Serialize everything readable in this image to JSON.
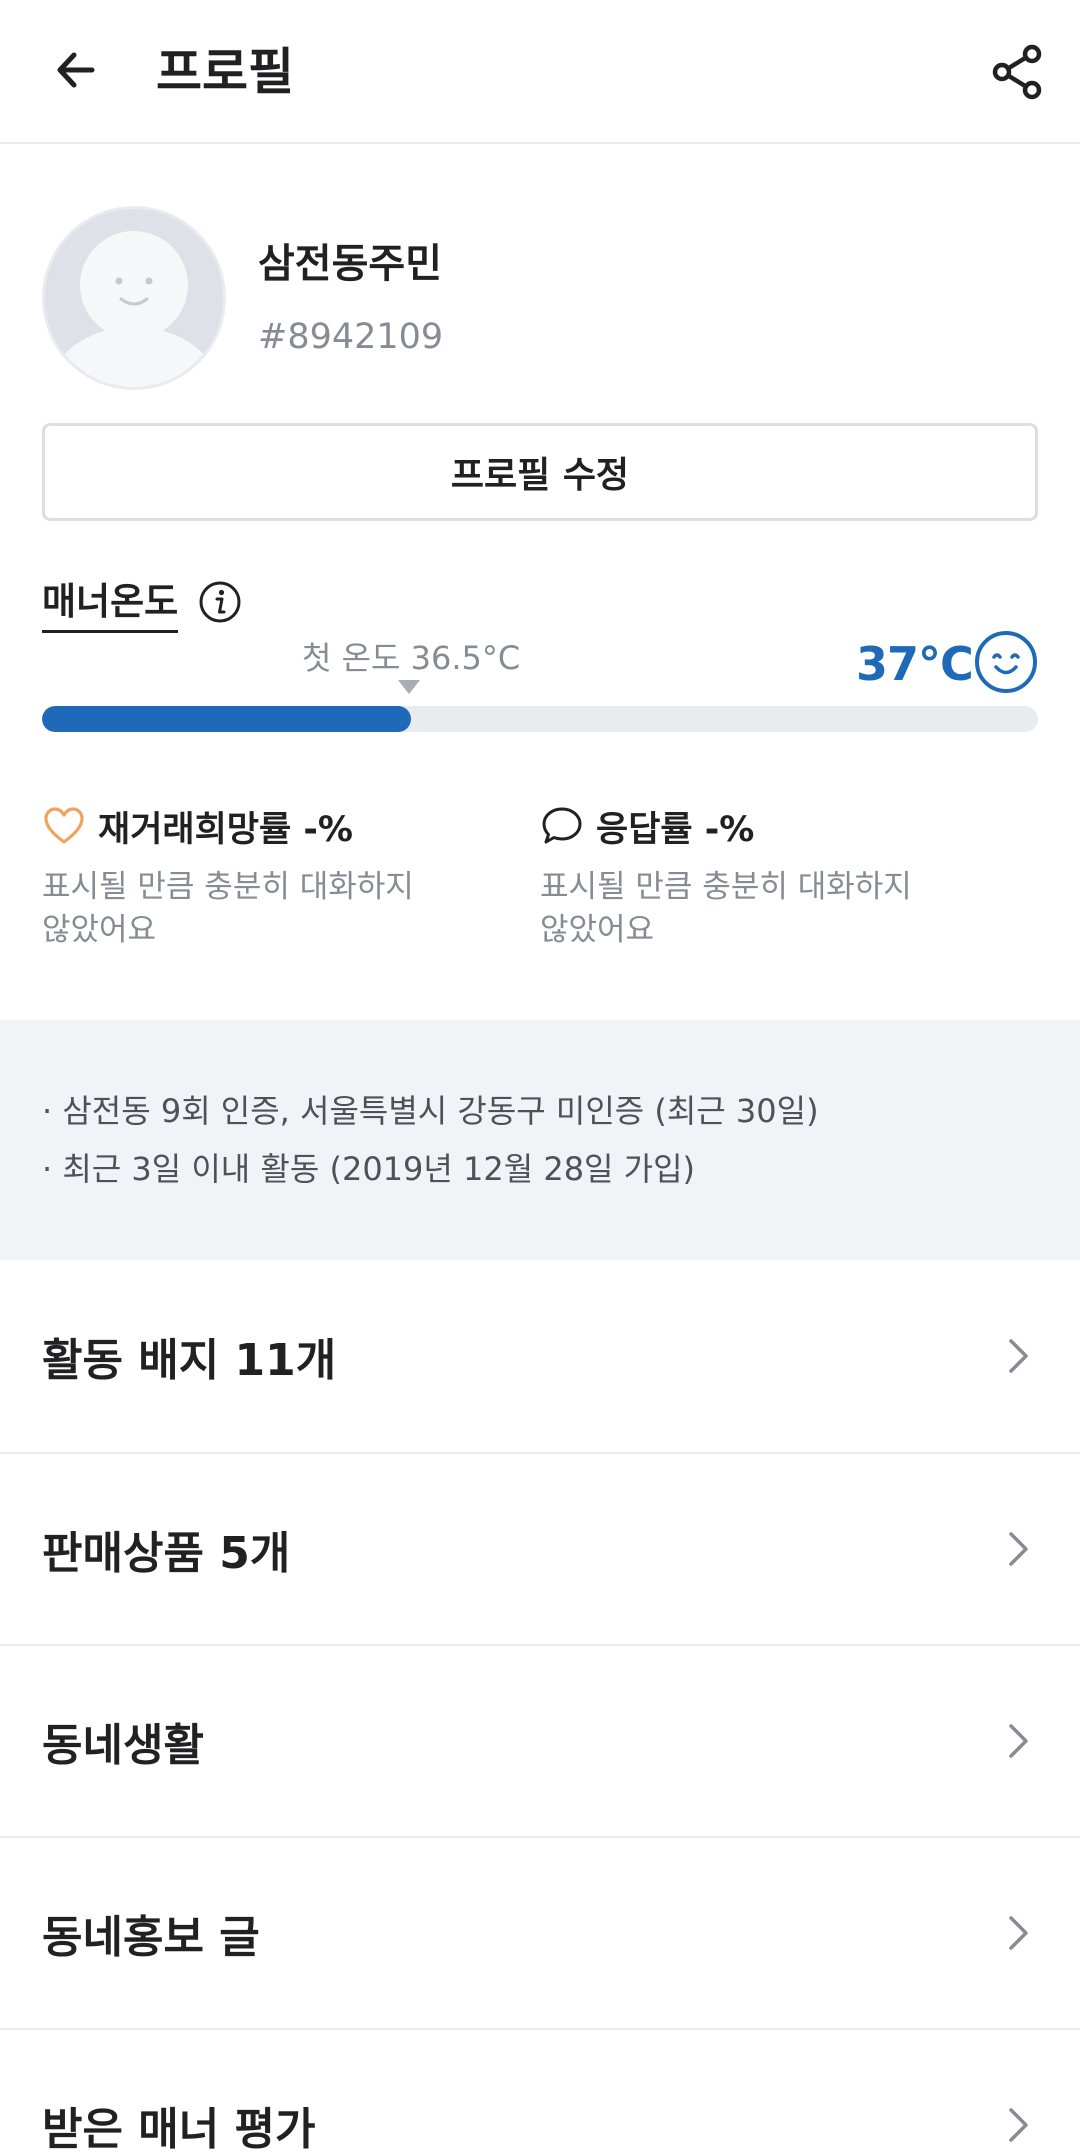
{
  "header": {
    "title": "프로필"
  },
  "profile": {
    "nickname": "삼전동주민",
    "user_id": "#8942109"
  },
  "edit_button": {
    "label": "프로필 수정"
  },
  "manner": {
    "label": "매너온도",
    "first_temp_label": "첫 온도 36.5°C",
    "temperature": "37°C",
    "progress": 0.37
  },
  "stats": [
    {
      "title": "재거래희망률 -%",
      "desc_line1": "표시될 만큼 충분히 대화하지",
      "desc_line2": "않았어요",
      "icon": "heart-icon"
    },
    {
      "title": "응답률 -%",
      "desc_line1": "표시될 만큼 충분히 대화하지",
      "desc_line2": "않았어요",
      "icon": "speech-bubble-icon"
    }
  ],
  "info": [
    "· 삼전동 9회 인증, 서울특별시 강동구 미인증 (최근 30일)",
    "· 최근 3일 이내 활동 (2019년 12월 28일 가입)"
  ],
  "menu": [
    {
      "label": "활동 배지 11개"
    },
    {
      "label": "판매상품 5개"
    },
    {
      "label": "동네생활"
    },
    {
      "label": "동네홍보 글"
    },
    {
      "label": "받은 매너 평가"
    }
  ],
  "colors": {
    "accent": "#1e6ab8",
    "heart": "#f0a35a",
    "muted": "#868b94"
  }
}
